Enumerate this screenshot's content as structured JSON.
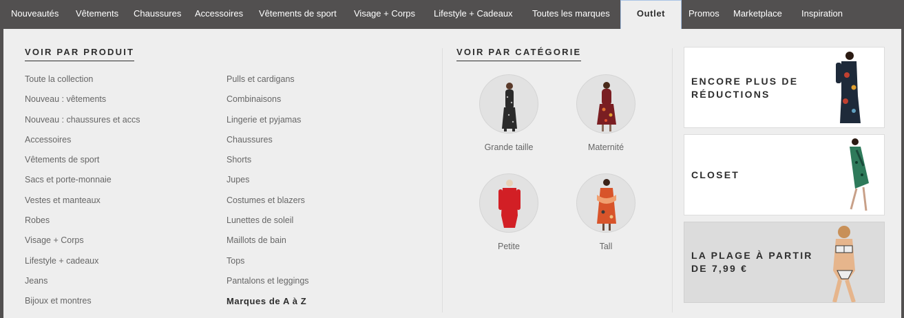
{
  "nav": {
    "items": [
      {
        "label": "Nouveautés"
      },
      {
        "label": "Vêtements"
      },
      {
        "label": "Chaussures"
      },
      {
        "label": "Accessoires"
      },
      {
        "label": "Vêtements de sport"
      },
      {
        "label": "Visage + Corps"
      },
      {
        "label": "Lifestyle + Cadeaux"
      },
      {
        "label": "Toutes les marques"
      },
      {
        "label": "Outlet",
        "active": true
      },
      {
        "label": "Promos"
      },
      {
        "label": "Marketplace"
      },
      {
        "label": "Inspiration"
      }
    ]
  },
  "product": {
    "title": "VOIR PAR PRODUIT",
    "col1": [
      "Toute la collection",
      "Nouveau : vêtements",
      "Nouveau : chaussures et accs",
      "Accessoires",
      "Vêtements de sport",
      "Sacs et porte-monnaie",
      "Vestes et manteaux",
      "Robes",
      "Visage + Corps",
      "Lifestyle + cadeaux",
      "Jeans",
      "Bijoux et montres"
    ],
    "col2": [
      "Pulls et cardigans",
      "Combinaisons",
      "Lingerie et pyjamas",
      "Chaussures",
      "Shorts",
      "Jupes",
      "Costumes et blazers",
      "Lunettes de soleil",
      "Maillots de bain",
      "Tops",
      "Pantalons et leggings",
      "Marques de A à Z"
    ]
  },
  "category": {
    "title": "VOIR PAR CATÉGORIE",
    "items": [
      {
        "label": "Grande taille",
        "icon": "model-black-dress-image",
        "color": "#2a2a2a"
      },
      {
        "label": "Maternité",
        "icon": "model-floral-dress-image",
        "color": "#7a1e22"
      },
      {
        "label": "Petite",
        "icon": "model-red-dress-image",
        "color": "#d21f25"
      },
      {
        "label": "Tall",
        "icon": "model-orange-dress-image",
        "color": "#d8542a"
      }
    ]
  },
  "promos": [
    {
      "text": "ENCORE PLUS DE RÉDUCTIONS",
      "image": "model-floral-dress-image"
    },
    {
      "text": "CLOSET",
      "image": "model-green-dress-image"
    },
    {
      "text": "LA PLAGE À PARTIR DE 7,99 €",
      "image": "model-bikini-image"
    }
  ],
  "colors": {
    "nav_bg": "#525050",
    "panel_bg": "#eeeeee",
    "text_dark": "#2d2d2d",
    "text_muted": "#666666",
    "active_border": "#a9c3e5"
  }
}
